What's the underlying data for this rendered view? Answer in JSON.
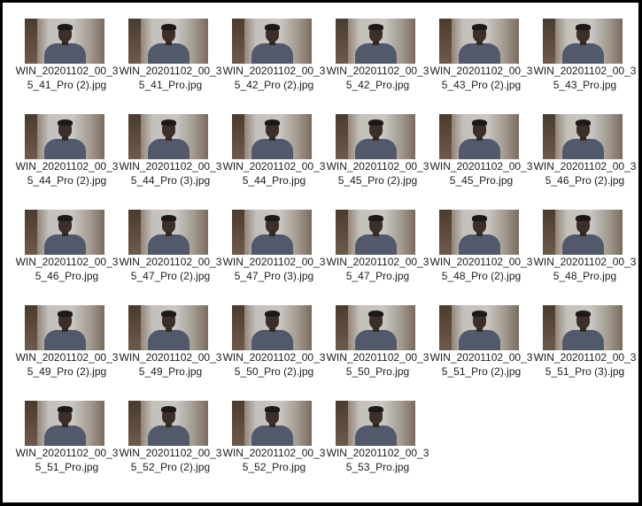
{
  "files": [
    {
      "name": "WIN_20201102_00_35_41_Pro (2).jpg"
    },
    {
      "name": "WIN_20201102_00_35_41_Pro.jpg"
    },
    {
      "name": "WIN_20201102_00_35_42_Pro (2).jpg"
    },
    {
      "name": "WIN_20201102_00_35_42_Pro.jpg"
    },
    {
      "name": "WIN_20201102_00_35_43_Pro (2).jpg"
    },
    {
      "name": "WIN_20201102_00_35_43_Pro.jpg"
    },
    {
      "name": "WIN_20201102_00_35_44_Pro (2).jpg"
    },
    {
      "name": "WIN_20201102_00_35_44_Pro (3).jpg"
    },
    {
      "name": "WIN_20201102_00_35_44_Pro.jpg"
    },
    {
      "name": "WIN_20201102_00_35_45_Pro (2).jpg"
    },
    {
      "name": "WIN_20201102_00_35_45_Pro.jpg"
    },
    {
      "name": "WIN_20201102_00_35_46_Pro (2).jpg"
    },
    {
      "name": "WIN_20201102_00_35_46_Pro.jpg"
    },
    {
      "name": "WIN_20201102_00_35_47_Pro (2).jpg"
    },
    {
      "name": "WIN_20201102_00_35_47_Pro (3).jpg"
    },
    {
      "name": "WIN_20201102_00_35_47_Pro.jpg"
    },
    {
      "name": "WIN_20201102_00_35_48_Pro (2).jpg"
    },
    {
      "name": "WIN_20201102_00_35_48_Pro.jpg"
    },
    {
      "name": "WIN_20201102_00_35_49_Pro (2).jpg"
    },
    {
      "name": "WIN_20201102_00_35_49_Pro.jpg"
    },
    {
      "name": "WIN_20201102_00_35_50_Pro (2).jpg"
    },
    {
      "name": "WIN_20201102_00_35_50_Pro.jpg"
    },
    {
      "name": "WIN_20201102_00_35_51_Pro (2).jpg"
    },
    {
      "name": "WIN_20201102_00_35_51_Pro (3).jpg"
    },
    {
      "name": "WIN_20201102_00_35_51_Pro.jpg"
    },
    {
      "name": "WIN_20201102_00_35_52_Pro (2).jpg"
    },
    {
      "name": "WIN_20201102_00_35_52_Pro.jpg"
    },
    {
      "name": "WIN_20201102_00_35_53_Pro.jpg"
    }
  ]
}
